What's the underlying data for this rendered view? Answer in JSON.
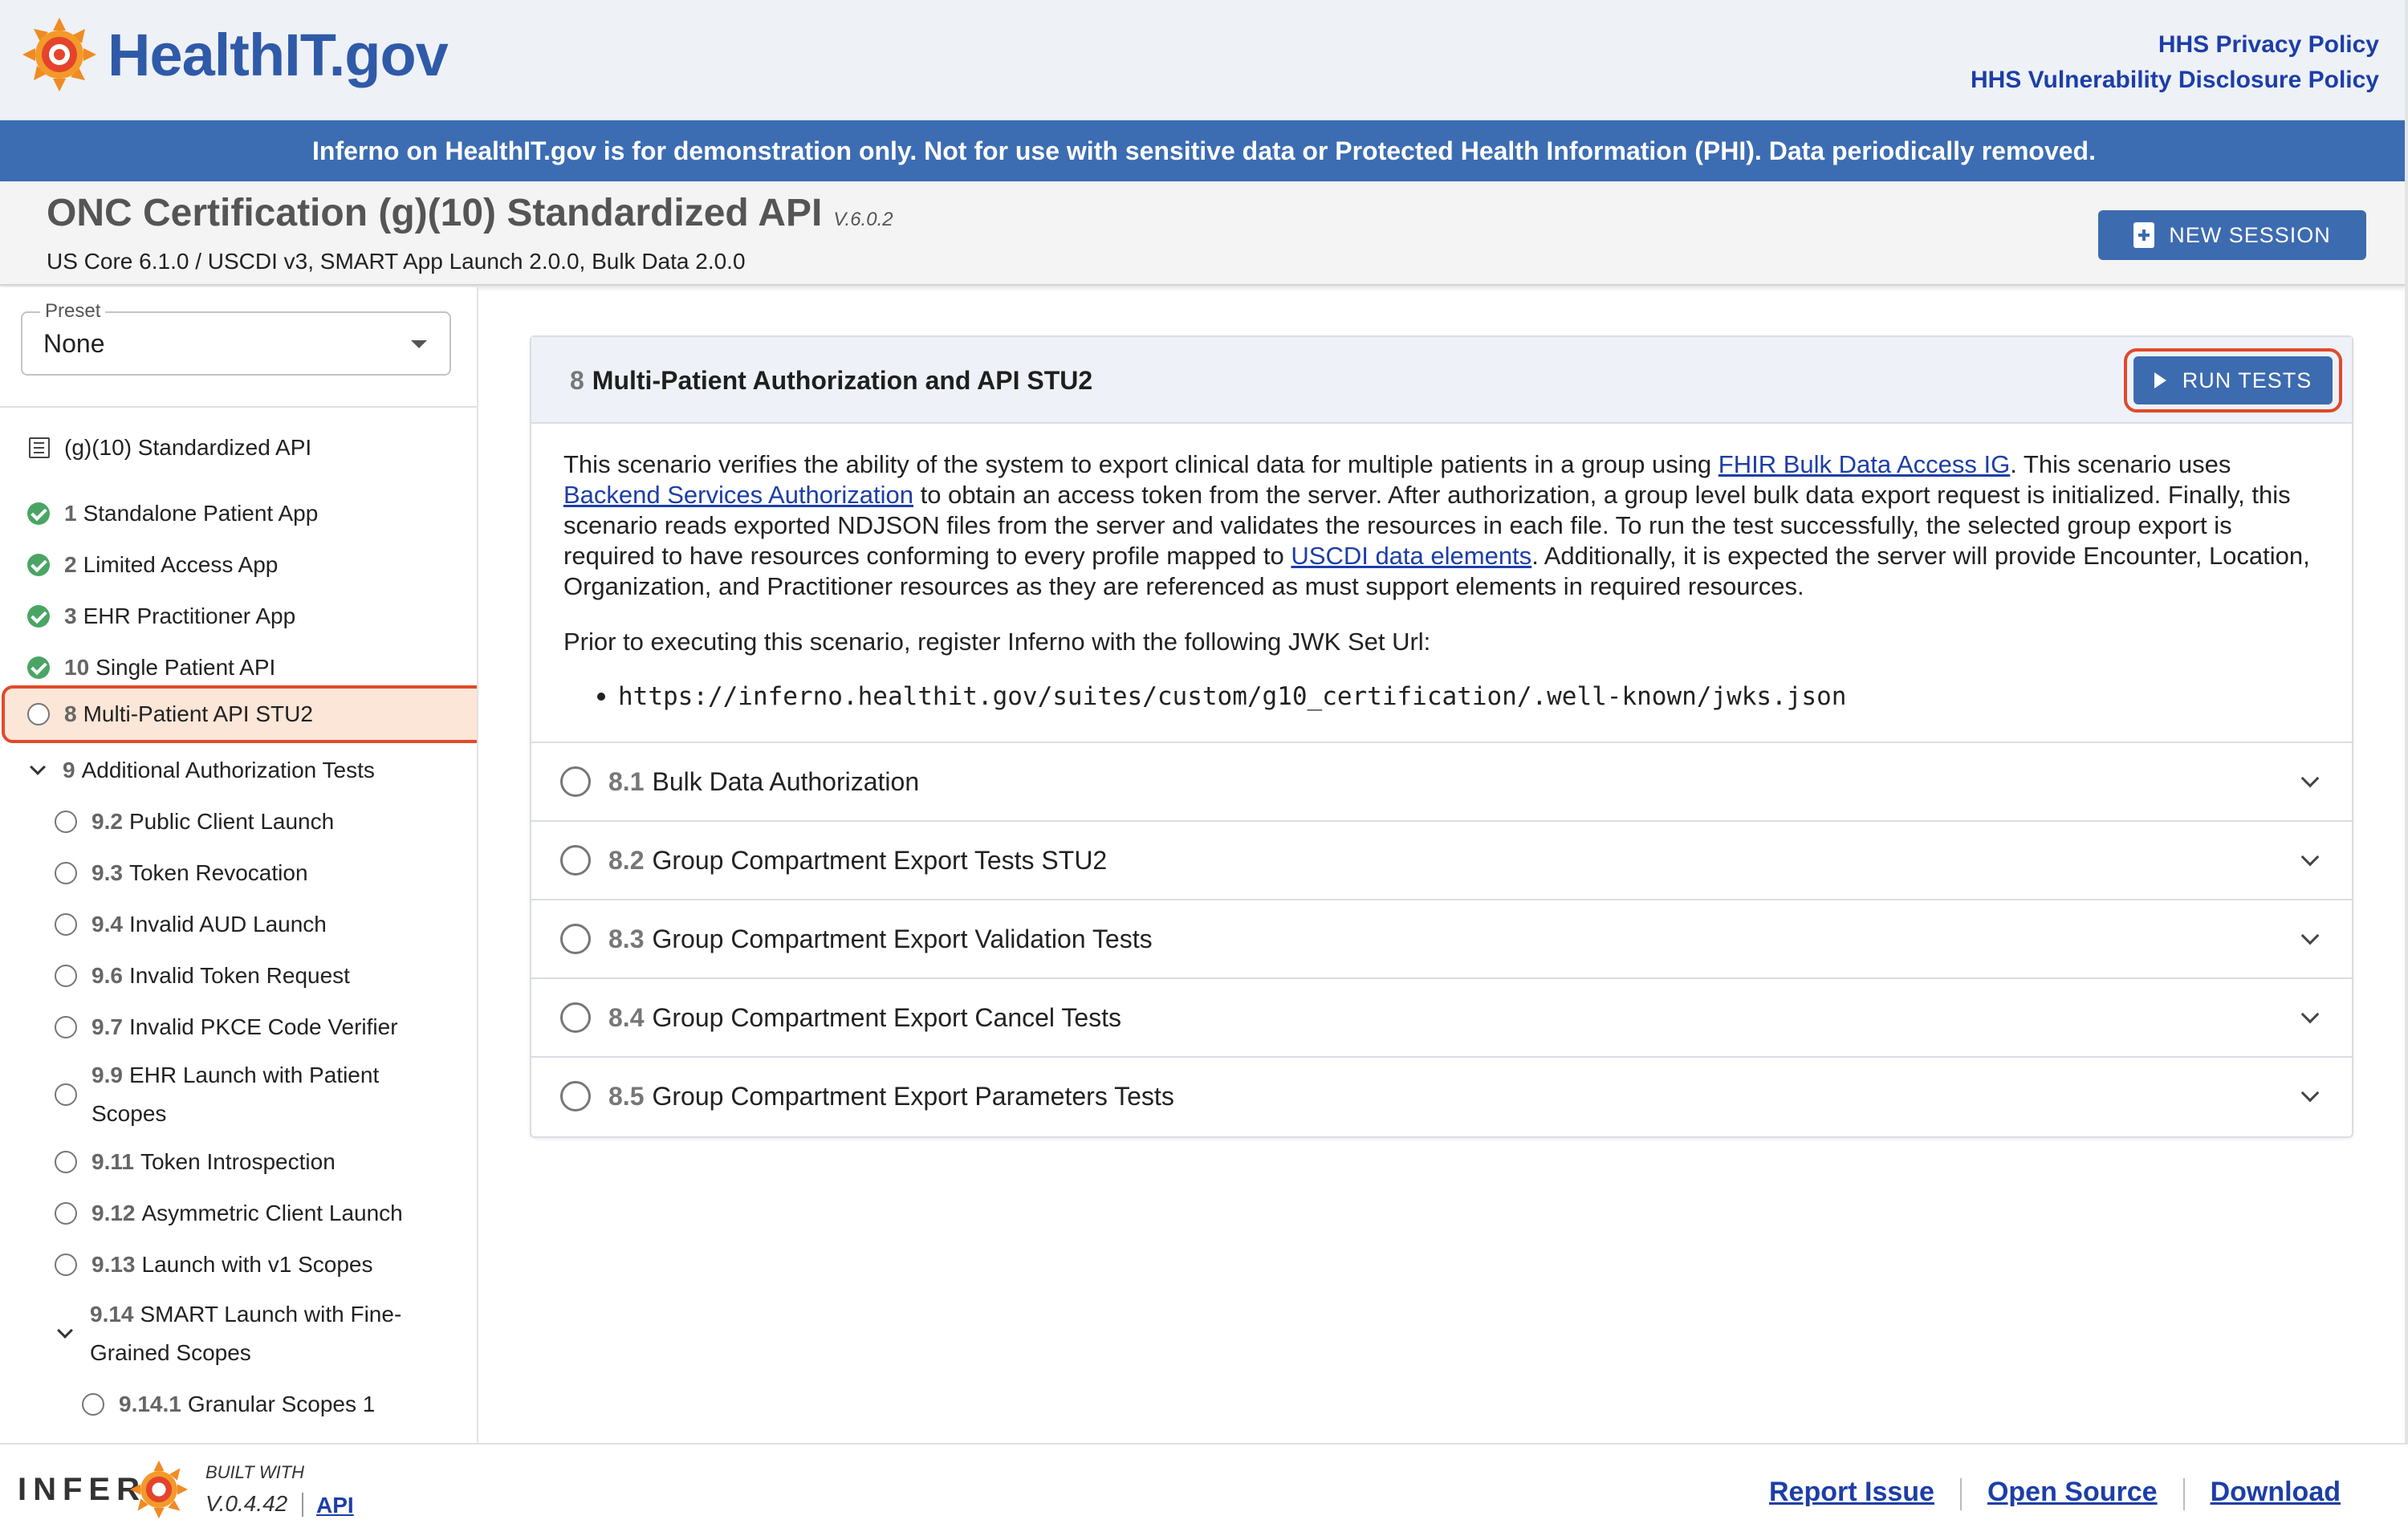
{
  "header": {
    "logo_text": "HealthIT.gov",
    "privacy_link": "HHS Privacy Policy",
    "vuln_link": "HHS Vulnerability Disclosure Policy"
  },
  "banner": {
    "text": "Inferno on HealthIT.gov is for demonstration only. Not for use with sensitive data or Protected Health Information (PHI). Data periodically removed."
  },
  "suite": {
    "title": "ONC Certification (g)(10) Standardized API",
    "version": "V.6.0.2",
    "subtitle": "US Core 6.1.0 / USCDI v3, SMART App Launch 2.0.0, Bulk Data 2.0.0",
    "new_session_label": "NEW SESSION"
  },
  "sidebar": {
    "preset_label": "Preset",
    "preset_value": "None",
    "root_label": "(g)(10) Standardized API",
    "items": [
      {
        "num": "1",
        "label": "Standalone Patient App",
        "status": "passed"
      },
      {
        "num": "2",
        "label": "Limited Access App",
        "status": "passed"
      },
      {
        "num": "3",
        "label": "EHR Practitioner App",
        "status": "passed"
      },
      {
        "num": "10",
        "label": "Single Patient API",
        "status": "passed"
      },
      {
        "num": "8",
        "label": "Multi-Patient API STU2",
        "status": "pending"
      },
      {
        "num": "9",
        "label": "Additional Authorization Tests",
        "status": "expanded"
      },
      {
        "num": "9.2",
        "label": "Public Client Launch",
        "status": "pending"
      },
      {
        "num": "9.3",
        "label": "Token Revocation",
        "status": "pending"
      },
      {
        "num": "9.4",
        "label": "Invalid AUD Launch",
        "status": "pending"
      },
      {
        "num": "9.6",
        "label": "Invalid Token Request",
        "status": "pending"
      },
      {
        "num": "9.7",
        "label": "Invalid PKCE Code Verifier",
        "status": "pending"
      },
      {
        "num": "9.9",
        "label": "EHR Launch with Patient",
        "label2": "Scopes",
        "status": "pending"
      },
      {
        "num": "9.11",
        "label": "Token Introspection",
        "status": "pending"
      },
      {
        "num": "9.12",
        "label": "Asymmetric Client Launch",
        "status": "pending"
      },
      {
        "num": "9.13",
        "label": "Launch with v1 Scopes",
        "status": "pending"
      },
      {
        "num": "9.14",
        "label": "SMART Launch with Fine-",
        "label2": "Grained Scopes",
        "status": "expanded"
      },
      {
        "num": "9.14.1",
        "label": "Granular Scopes 1",
        "status": "pending"
      }
    ]
  },
  "main": {
    "group_num": "8",
    "group_title": "Multi-Patient Authorization and API STU2",
    "run_tests_label": "RUN TESTS",
    "desc_p1": "This scenario verifies the ability of the system to export clinical data for multiple patients in a group using ",
    "desc_link1": "FHIR Bulk Data Access IG",
    "desc_p2": ". This scenario uses ",
    "desc_link2": "Backend Services Authorization",
    "desc_p3": " to obtain an access token from the server. After authorization, a group level bulk data export request is initialized. Finally, this scenario reads exported NDJSON files from the server and validates the resources in each file. To run the test successfully, the selected group export is required to have resources conforming to every profile mapped to ",
    "desc_link3": "USCDI data elements",
    "desc_p4": ". Additionally, it is expected the server will provide Encounter, Location, Organization, and Practitioner resources as they are referenced as must support elements in required resources.",
    "jwk_intro": "Prior to executing this scenario, register Inferno with the following JWK Set Url:",
    "jwk_url": "https://inferno.healthit.gov/suites/custom/g10_certification/.well-known/jwks.json",
    "tests": [
      {
        "num": "8.1",
        "label": "Bulk Data Authorization"
      },
      {
        "num": "8.2",
        "label": "Group Compartment Export Tests STU2"
      },
      {
        "num": "8.3",
        "label": "Group Compartment Export Validation Tests"
      },
      {
        "num": "8.4",
        "label": "Group Compartment Export Cancel Tests"
      },
      {
        "num": "8.5",
        "label": "Group Compartment Export Parameters Tests"
      }
    ]
  },
  "footer": {
    "inferno_word": "INFERN",
    "built_with": "BUILT WITH",
    "version": "V.0.4.42",
    "api_link": "API",
    "report_issue": "Report Issue",
    "open_source": "Open Source",
    "download": "Download"
  },
  "colors": {
    "brand_blue": "#3d6bb0",
    "banner_blue": "#3c6db3",
    "link_blue": "#1c3ea8",
    "pass_green": "#4aa564",
    "highlight_red": "#e04a2a",
    "selected_bg": "#fbe6d7"
  }
}
